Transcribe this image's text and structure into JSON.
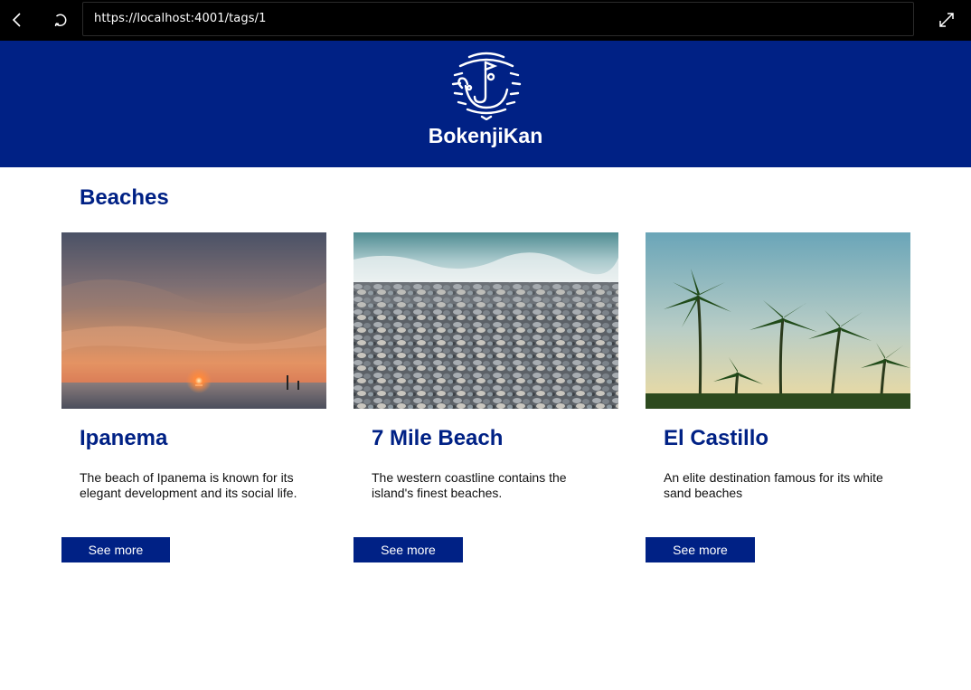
{
  "browser": {
    "url": "https://localhost:4001/tags/1",
    "back_icon": "chevron-left-icon",
    "reload_icon": "reload-icon",
    "fullscreen_icon": "expand-icon"
  },
  "header": {
    "brand": "BokenjiKan",
    "logo_icon": "bokenjikan-logo",
    "background": "#002185"
  },
  "page": {
    "title": "Beaches"
  },
  "cards": [
    {
      "title": "Ipanema",
      "description": "The beach of Ipanema is known for its elegant development and its social life.",
      "button": "See more",
      "image": "sunset-over-sea-photo"
    },
    {
      "title": "7 Mile Beach",
      "description": "The western coastline contains the island's finest beaches.",
      "button": "See more",
      "image": "pebble-beach-photo"
    },
    {
      "title": "El Castillo",
      "description": "An elite destination famous for its white sand beaches",
      "button": "See more",
      "image": "palm-trees-photo"
    }
  ],
  "colors": {
    "brand_blue": "#002185",
    "browser_bar": "#000000"
  }
}
